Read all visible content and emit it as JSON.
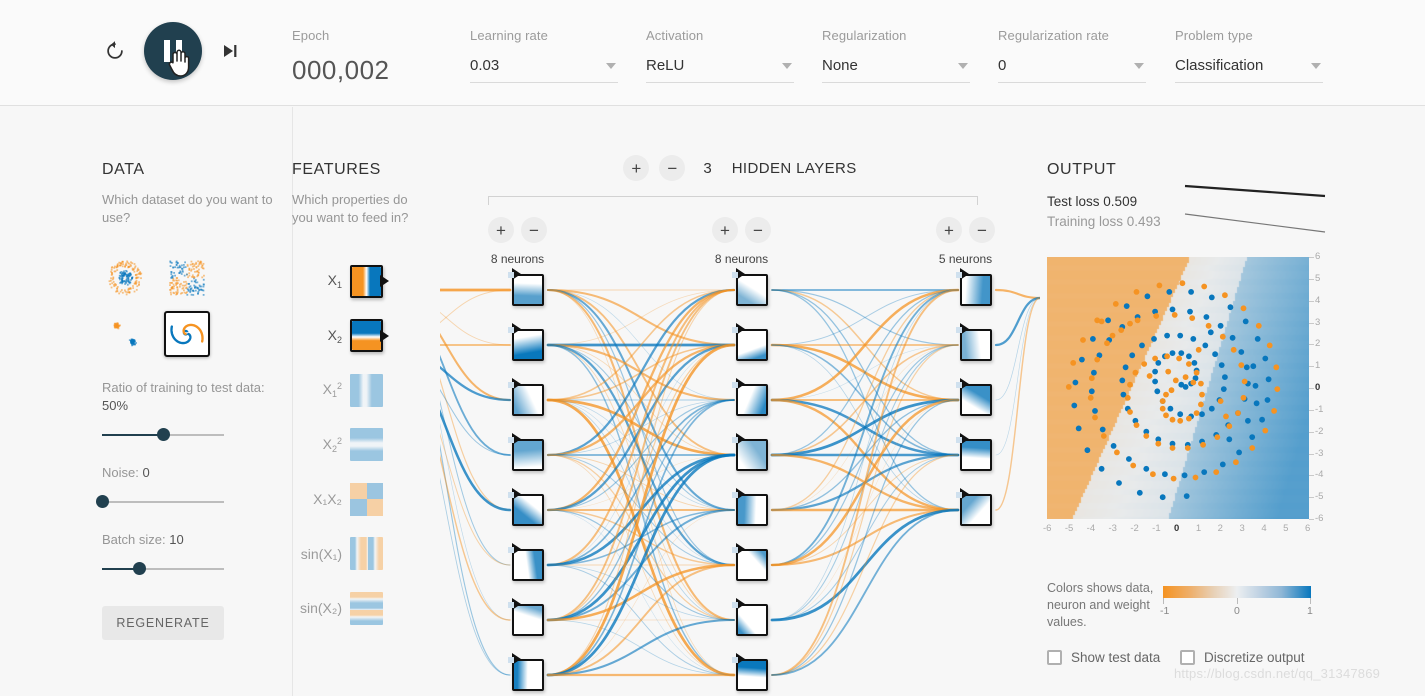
{
  "toolbar": {
    "reset_icon": "reset-icon",
    "play_pause_icon": "pause-icon",
    "step_icon": "step-forward-icon",
    "epoch_label": "Epoch",
    "epoch_value": "000,002",
    "controls": [
      {
        "label": "Learning rate",
        "value": "0.03",
        "name": "learning-rate"
      },
      {
        "label": "Activation",
        "value": "ReLU",
        "name": "activation"
      },
      {
        "label": "Regularization",
        "value": "None",
        "name": "regularization"
      },
      {
        "label": "Regularization rate",
        "value": "0",
        "name": "regularization-rate"
      },
      {
        "label": "Problem type",
        "value": "Classification",
        "name": "problem-type"
      }
    ]
  },
  "data_panel": {
    "title": "DATA",
    "subtitle": "Which dataset do you want to use?",
    "datasets": [
      {
        "name": "circle",
        "selected": false
      },
      {
        "name": "exclusive-or",
        "selected": false
      },
      {
        "name": "gaussian",
        "selected": false
      },
      {
        "name": "spiral",
        "selected": true
      }
    ],
    "ratio_label": "Ratio of training to test data:",
    "ratio_value": "50%",
    "ratio_pct": 50,
    "noise_label": "Noise:",
    "noise_value": "0",
    "noise_pct": 0,
    "batch_label": "Batch size:",
    "batch_value": "10",
    "batch_pct": 30,
    "regenerate_label": "REGENERATE"
  },
  "features_panel": {
    "title": "FEATURES",
    "subtitle": "Which properties do you want to feed in?",
    "features": [
      {
        "label": "X",
        "sub": "1",
        "sup": "",
        "active": true
      },
      {
        "label": "X",
        "sub": "2",
        "sup": "",
        "active": true
      },
      {
        "label": "X",
        "sub": "1",
        "sup": "2",
        "active": false
      },
      {
        "label": "X",
        "sub": "2",
        "sup": "2",
        "active": false
      },
      {
        "label": "X₁X₂",
        "sub": "",
        "sup": "",
        "active": false
      },
      {
        "label": "sin(X₁)",
        "sub": "",
        "sup": "",
        "active": false
      },
      {
        "label": "sin(X₂)",
        "sub": "",
        "sup": "",
        "active": false
      }
    ]
  },
  "network": {
    "add_layer_label": "+",
    "remove_layer_label": "−",
    "hidden_layer_count": "3",
    "hidden_layers_label": "HIDDEN LAYERS",
    "layers": [
      {
        "neurons": 8,
        "neuron_label": "8 neurons"
      },
      {
        "neurons": 8,
        "neuron_label": "8 neurons"
      },
      {
        "neurons": 5,
        "neuron_label": "5 neurons"
      }
    ]
  },
  "output_panel": {
    "title": "OUTPUT",
    "test_loss_label": "Test loss",
    "test_loss_value": "0.509",
    "training_loss_label": "Training loss",
    "training_loss_value": "0.493",
    "x_ticks": [
      "-6",
      "-5",
      "-4",
      "-3",
      "-2",
      "-1",
      "0",
      "1",
      "2",
      "3",
      "4",
      "5",
      "6"
    ],
    "y_ticks": [
      "6",
      "5",
      "4",
      "3",
      "2",
      "1",
      "0",
      "-1",
      "-2",
      "-3",
      "-4",
      "-5",
      "-6"
    ],
    "legend_text": "Colors shows data, neuron and weight values.",
    "gradient_min": "-1",
    "gradient_mid": "0",
    "gradient_max": "1",
    "show_test_data_label": "Show test data",
    "discretize_output_label": "Discretize output",
    "show_test_data_checked": false,
    "discretize_output_checked": false
  },
  "colors": {
    "negative": "#f59322",
    "positive": "#0877bd",
    "neutral": "#e8eaeb",
    "accent_dark": "#21404f"
  },
  "watermark": "https://blog.csdn.net/qq_31347869",
  "chart_data": {
    "type": "scatter",
    "title": "Output decision boundary (spiral dataset)",
    "xlabel": "",
    "ylabel": "",
    "xlim": [
      -6,
      6
    ],
    "ylim": [
      -6,
      6
    ],
    "grid": false,
    "legend": "none",
    "series": [
      {
        "name": "class-positive-blue",
        "color": "#0877bd",
        "points": [
          [
            0.35,
            0.05
          ],
          [
            0.6,
            0.2
          ],
          [
            0.8,
            0.45
          ],
          [
            0.85,
            0.8
          ],
          [
            0.75,
            1.15
          ],
          [
            0.5,
            1.45
          ],
          [
            0.15,
            1.6
          ],
          [
            -0.25,
            1.6
          ],
          [
            -0.6,
            1.45
          ],
          [
            -0.9,
            1.15
          ],
          [
            -1.05,
            0.75
          ],
          [
            -1.05,
            0.3
          ],
          [
            -0.95,
            -0.15
          ],
          [
            -0.7,
            -0.6
          ],
          [
            -0.35,
            -0.95
          ],
          [
            0.1,
            -1.2
          ],
          [
            0.6,
            -1.3
          ],
          [
            1.1,
            -1.2
          ],
          [
            1.55,
            -0.95
          ],
          [
            1.9,
            -0.55
          ],
          [
            2.1,
            -0.05
          ],
          [
            2.15,
            0.5
          ],
          [
            2.0,
            1.05
          ],
          [
            1.7,
            1.55
          ],
          [
            1.25,
            1.95
          ],
          [
            0.7,
            2.25
          ],
          [
            0.1,
            2.4
          ],
          [
            -0.5,
            2.4
          ],
          [
            -1.1,
            2.25
          ],
          [
            -1.65,
            1.95
          ],
          [
            -2.1,
            1.5
          ],
          [
            -2.4,
            0.95
          ],
          [
            -2.55,
            0.35
          ],
          [
            -2.5,
            -0.3
          ],
          [
            -2.3,
            -0.95
          ],
          [
            -1.95,
            -1.5
          ],
          [
            -1.45,
            -2.0
          ],
          [
            -0.9,
            -2.35
          ],
          [
            -0.25,
            -2.55
          ],
          [
            0.45,
            -2.6
          ],
          [
            1.1,
            -2.45
          ],
          [
            1.75,
            -2.15
          ],
          [
            2.3,
            -1.7
          ],
          [
            2.75,
            -1.15
          ],
          [
            3.05,
            -0.5
          ],
          [
            3.2,
            0.2
          ],
          [
            3.15,
            0.95
          ],
          [
            2.9,
            1.65
          ],
          [
            2.5,
            2.3
          ],
          [
            1.95,
            2.85
          ],
          [
            1.3,
            3.25
          ],
          [
            0.55,
            3.5
          ],
          [
            -0.25,
            3.6
          ],
          [
            -1.05,
            3.5
          ],
          [
            -1.85,
            3.25
          ],
          [
            -2.55,
            2.8
          ],
          [
            -3.15,
            2.2
          ],
          [
            -3.6,
            1.5
          ],
          [
            -3.85,
            0.7
          ],
          [
            -3.95,
            -0.15
          ],
          [
            -3.8,
            -1.05
          ],
          [
            -3.45,
            -1.9
          ],
          [
            -2.95,
            -2.65
          ],
          [
            -2.25,
            -3.25
          ],
          [
            -1.45,
            -3.7
          ],
          [
            -0.6,
            -3.95
          ],
          [
            0.3,
            -4.0
          ],
          [
            1.2,
            -3.85
          ],
          [
            2.05,
            -3.5
          ],
          [
            2.8,
            -2.95
          ],
          [
            3.4,
            -2.25
          ],
          [
            3.85,
            -1.45
          ],
          [
            4.1,
            -0.55
          ],
          [
            4.15,
            0.4
          ],
          [
            4.0,
            1.35
          ],
          [
            3.65,
            2.25
          ],
          [
            3.1,
            3.05
          ],
          [
            2.4,
            3.7
          ],
          [
            1.55,
            4.15
          ],
          [
            0.6,
            4.4
          ],
          [
            -0.4,
            4.4
          ],
          [
            -1.4,
            4.2
          ],
          [
            -2.35,
            3.75
          ],
          [
            -3.2,
            3.1
          ],
          [
            -3.9,
            2.25
          ],
          [
            -4.4,
            1.3
          ],
          [
            -4.7,
            0.25
          ],
          [
            -4.75,
            -0.8
          ],
          [
            -4.55,
            -1.85
          ],
          [
            -4.15,
            -2.85
          ],
          [
            -3.5,
            -3.7
          ],
          [
            -2.7,
            -4.35
          ],
          [
            -1.75,
            -4.8
          ],
          [
            -0.7,
            -5.0
          ],
          [
            0.4,
            -4.95
          ],
          [
            0.15,
            0.15
          ],
          [
            3.55,
            0.1
          ],
          [
            3.6,
            -0.7
          ],
          [
            3.45,
            1.0
          ],
          [
            3.2,
            -1.5
          ],
          [
            2.35,
            -2.35
          ],
          [
            1.5,
            2.55
          ]
        ]
      },
      {
        "name": "class-negative-orange",
        "color": "#f59322",
        "points": [
          [
            -0.3,
            -0.1
          ],
          [
            -0.55,
            -0.3
          ],
          [
            -0.7,
            -0.6
          ],
          [
            -0.7,
            -0.95
          ],
          [
            -0.55,
            -1.25
          ],
          [
            -0.25,
            -1.45
          ],
          [
            0.1,
            -1.5
          ],
          [
            0.5,
            -1.4
          ],
          [
            0.85,
            -1.15
          ],
          [
            1.05,
            -0.75
          ],
          [
            1.1,
            -0.3
          ],
          [
            1.05,
            0.2
          ],
          [
            0.85,
            0.7
          ],
          [
            0.5,
            1.1
          ],
          [
            0.05,
            1.35
          ],
          [
            -0.5,
            1.45
          ],
          [
            -1.05,
            1.35
          ],
          [
            -1.55,
            1.1
          ],
          [
            -1.95,
            0.7
          ],
          [
            -2.2,
            0.15
          ],
          [
            -2.3,
            -0.45
          ],
          [
            -2.2,
            -1.1
          ],
          [
            -1.9,
            -1.7
          ],
          [
            -1.45,
            -2.2
          ],
          [
            -0.9,
            -2.55
          ],
          [
            -0.25,
            -2.75
          ],
          [
            0.45,
            -2.75
          ],
          [
            1.15,
            -2.6
          ],
          [
            1.8,
            -2.25
          ],
          [
            2.35,
            -1.75
          ],
          [
            2.75,
            -1.15
          ],
          [
            3.0,
            -0.45
          ],
          [
            3.05,
            0.3
          ],
          [
            2.9,
            1.05
          ],
          [
            2.55,
            1.75
          ],
          [
            2.05,
            2.35
          ],
          [
            1.4,
            2.85
          ],
          [
            0.65,
            3.2
          ],
          [
            -0.15,
            3.35
          ],
          [
            -1.0,
            3.3
          ],
          [
            -1.85,
            3.1
          ],
          [
            -2.6,
            2.65
          ],
          [
            -3.25,
            2.05
          ],
          [
            -3.7,
            1.3
          ],
          [
            -3.95,
            0.45
          ],
          [
            -4.0,
            -0.45
          ],
          [
            -3.8,
            -1.35
          ],
          [
            -3.4,
            -2.2
          ],
          [
            -2.8,
            -2.95
          ],
          [
            -2.05,
            -3.55
          ],
          [
            -1.15,
            -3.95
          ],
          [
            -0.2,
            -4.15
          ],
          [
            0.8,
            -4.1
          ],
          [
            1.75,
            -3.85
          ],
          [
            2.65,
            -3.4
          ],
          [
            3.4,
            -2.75
          ],
          [
            4.0,
            -1.95
          ],
          [
            4.4,
            -1.05
          ],
          [
            4.55,
            -0.05
          ],
          [
            4.5,
            0.95
          ],
          [
            4.2,
            1.95
          ],
          [
            3.7,
            2.85
          ],
          [
            3.0,
            3.65
          ],
          [
            2.15,
            4.25
          ],
          [
            1.2,
            4.65
          ],
          [
            0.2,
            4.8
          ],
          [
            -0.85,
            4.7
          ],
          [
            -1.9,
            4.4
          ],
          [
            -2.85,
            3.85
          ],
          [
            -3.7,
            3.1
          ],
          [
            -4.35,
            2.2
          ],
          [
            -4.8,
            1.15
          ],
          [
            -5.0,
            0.05
          ],
          [
            -0.1,
            0.35
          ],
          [
            0.35,
            0.5
          ],
          [
            0.7,
            0.25
          ],
          [
            -3.5,
            3.05
          ],
          [
            -2.2,
            2.95
          ],
          [
            -3.0,
            2.4
          ],
          [
            1.95,
            -0.6
          ],
          [
            2.2,
            -1.3
          ],
          [
            -0.45,
            0.75
          ],
          [
            -1.3,
            0.55
          ],
          [
            0.95,
            1.75
          ]
        ]
      }
    ],
    "background": {
      "description": "decision boundary heatmap: orange region on upper-left, light blue wedge on right, pale neutral in center",
      "negative_color": "#f0dcc8",
      "positive_color": "#c8dcee",
      "neutral_color": "#eceff1"
    }
  },
  "loss_curve": {
    "type": "line",
    "series": [
      {
        "name": "test-loss",
        "color": "#222",
        "values": [
          0.53,
          0.509
        ]
      },
      {
        "name": "training-loss",
        "color": "#777",
        "values": [
          0.515,
          0.493
        ]
      }
    ],
    "x": [
      0,
      2
    ]
  }
}
